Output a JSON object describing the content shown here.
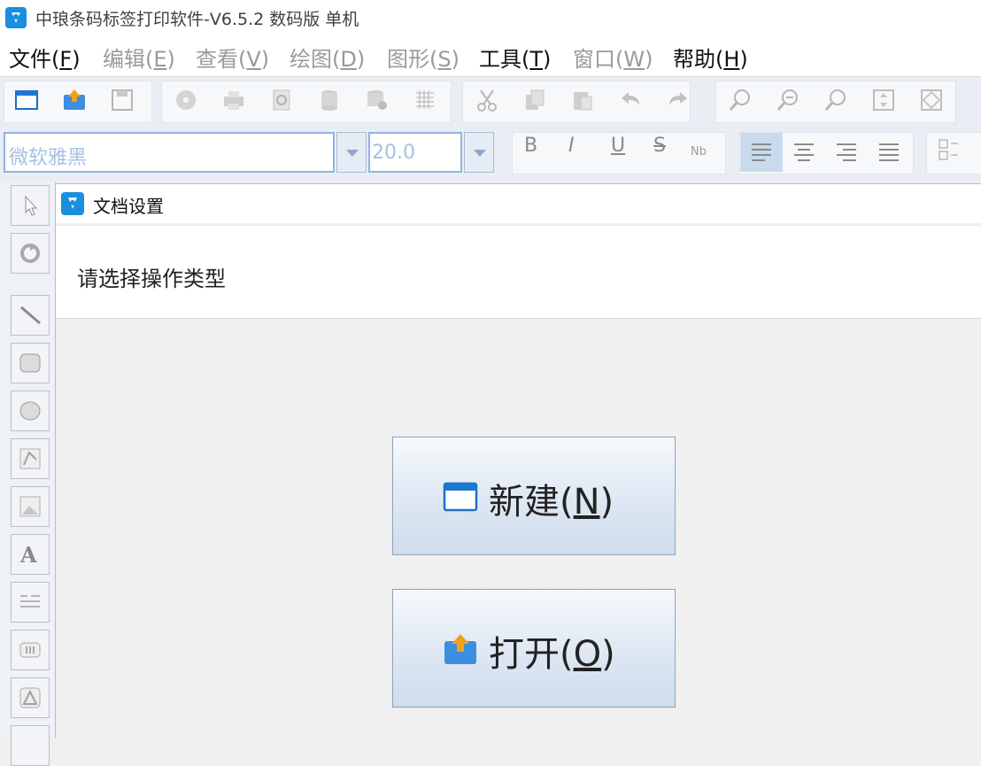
{
  "window": {
    "title": "中琅条码标签打印软件-V6.5.2 数码版 单机"
  },
  "menu": [
    {
      "label": "文件(",
      "key": "F",
      "end": ")",
      "enabled": true
    },
    {
      "label": "编辑(",
      "key": "E",
      "end": ")",
      "enabled": false
    },
    {
      "label": "查看(",
      "key": "V",
      "end": ")",
      "enabled": false
    },
    {
      "label": "绘图(",
      "key": "D",
      "end": ")",
      "enabled": false
    },
    {
      "label": "图形(",
      "key": "S",
      "end": ")",
      "enabled": false
    },
    {
      "label": "工具(",
      "key": "T",
      "end": ")",
      "enabled": true
    },
    {
      "label": "窗口(",
      "key": "W",
      "end": ")",
      "enabled": false
    },
    {
      "label": "帮助(",
      "key": "H",
      "end": ")",
      "enabled": true
    }
  ],
  "format_toolbar": {
    "font_name": "微软雅黑",
    "font_size": "20.0",
    "bold": "B",
    "italic": "I",
    "underline": "U",
    "strike": "S"
  },
  "dialog": {
    "title": "文档设置",
    "prompt": "请选择操作类型",
    "new_button": {
      "text": "新建(",
      "key": "N",
      "end": ")"
    },
    "open_button": {
      "text": "打开(",
      "key": "O",
      "end": ")"
    }
  },
  "colors": {
    "accent": "#1a8ee0",
    "button_gradient_bottom": "#cfdceb"
  }
}
